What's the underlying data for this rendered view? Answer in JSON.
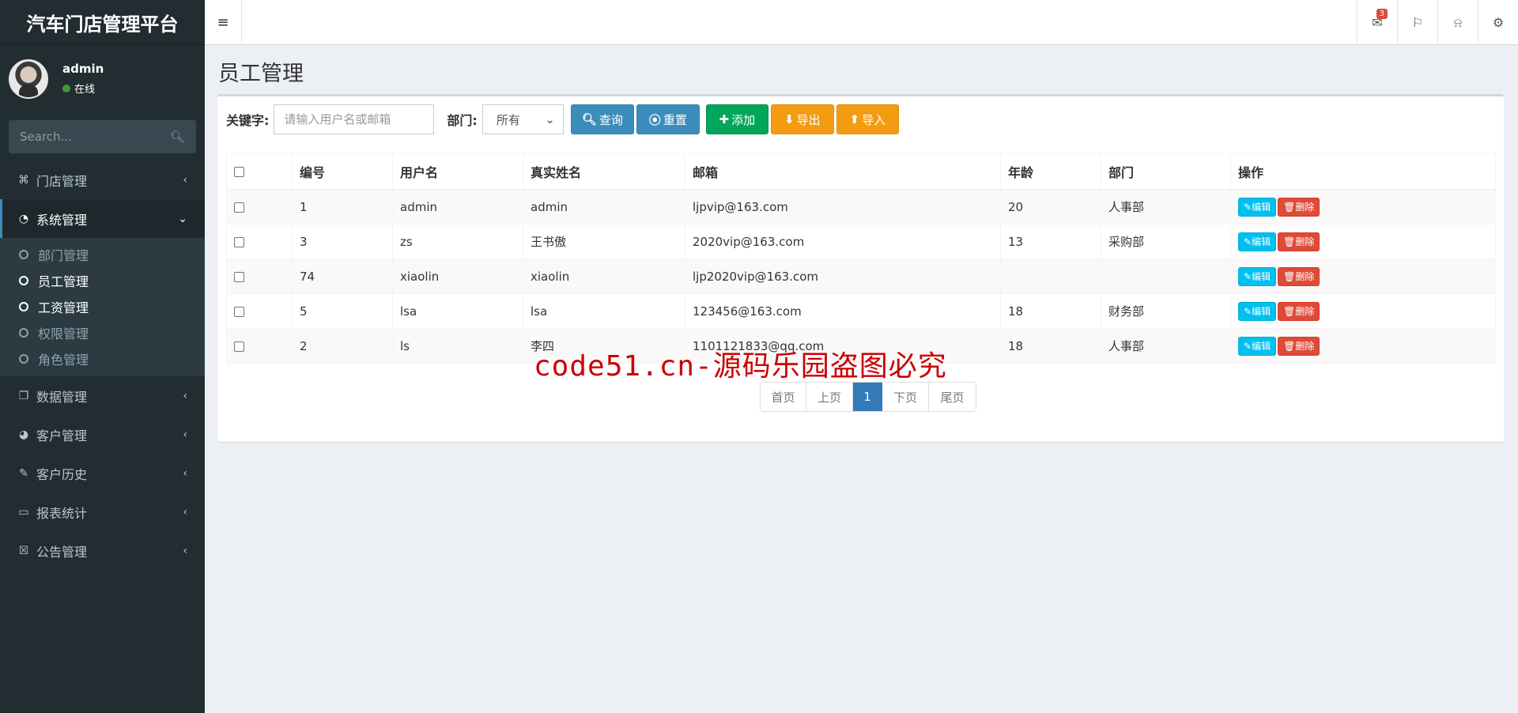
{
  "app_title": "汽车门店管理平台",
  "user": {
    "name": "admin",
    "status": "在线"
  },
  "sidebar_search": {
    "placeholder": "Search..."
  },
  "menu": {
    "store": "门店管理",
    "system": "系统管理",
    "system_sub": [
      "部门管理",
      "员工管理",
      "工资管理",
      "权限管理",
      "角色管理"
    ],
    "data": "数据管理",
    "customer": "客户管理",
    "customer_history": "客户历史",
    "report": "报表统计",
    "notice": "公告管理"
  },
  "topbar": {
    "mail_badge": "3"
  },
  "page": {
    "title": "员工管理"
  },
  "filter": {
    "keyword_label": "关键字:",
    "keyword_placeholder": "请输入用户名或邮箱",
    "dept_label": "部门:",
    "dept_value": "所有",
    "btn_query": "查询",
    "btn_reset": "重置",
    "btn_add": "添加",
    "btn_export": "导出",
    "btn_import": "导入"
  },
  "table": {
    "headers": [
      "编号",
      "用户名",
      "真实姓名",
      "邮箱",
      "年龄",
      "部门",
      "操作"
    ],
    "rows": [
      [
        "1",
        "admin",
        "admin",
        "ljpvip@163.com",
        "20",
        "人事部"
      ],
      [
        "3",
        "zs",
        "王书傲",
        "2020vip@163.com",
        "13",
        "采购部"
      ],
      [
        "74",
        "xiaolin",
        "xiaolin",
        "ljp2020vip@163.com",
        "",
        ""
      ],
      [
        "5",
        "lsa",
        "lsa",
        "123456@163.com",
        "18",
        "财务部"
      ],
      [
        "2",
        "ls",
        "李四",
        "1101121833@qq.com",
        "18",
        "人事部"
      ]
    ],
    "edit_label": "编辑",
    "delete_label": "删除"
  },
  "pager": {
    "first": "首页",
    "prev": "上页",
    "current": "1",
    "next": "下页",
    "last": "尾页"
  },
  "watermark": "code51.cn-源码乐园盗图必究"
}
